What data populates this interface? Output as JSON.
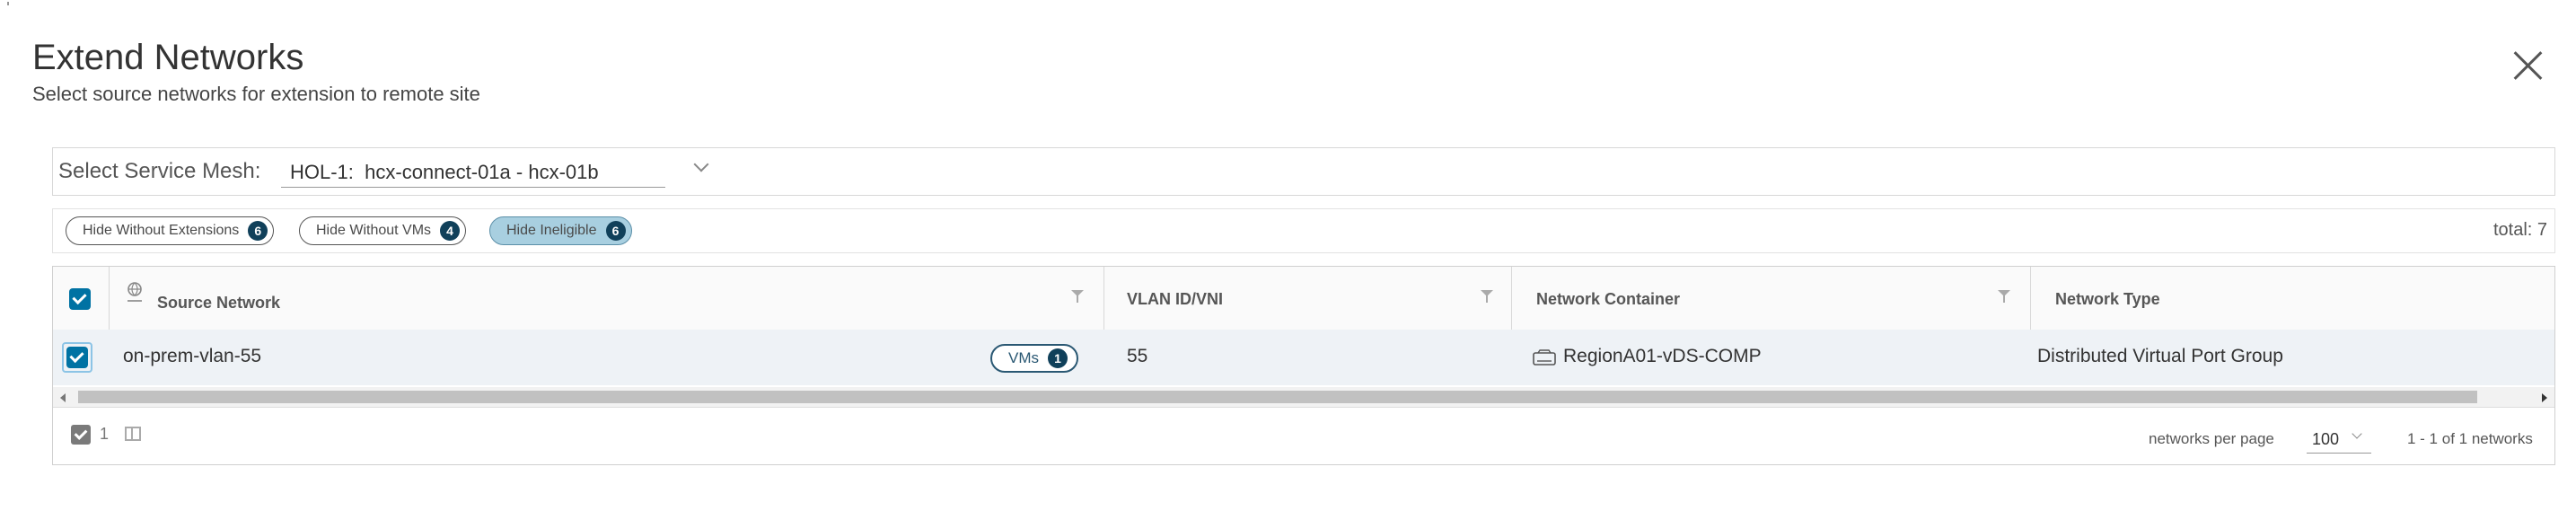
{
  "dialog": {
    "title": "Extend Networks",
    "subtitle": "Select source networks for extension to remote site"
  },
  "mesh": {
    "label": "Select Service Mesh:",
    "selected": "HOL-1:  hcx-connect-01a - hcx-01b"
  },
  "filters": [
    {
      "label": "Hide Without Extensions",
      "count": "6",
      "active": false
    },
    {
      "label": "Hide Without VMs",
      "count": "4",
      "active": false
    },
    {
      "label": "Hide Ineligible",
      "count": "6",
      "active": true
    }
  ],
  "total": "total: 7",
  "grid": {
    "columns": [
      "Source Network",
      "VLAN ID/VNI",
      "Network Container",
      "Network Type"
    ],
    "rows": [
      {
        "source": "on-prem-vlan-55",
        "vms_label": "VMs",
        "vms_count": "1",
        "vlan": "55",
        "container": "RegionA01-vDS-COMP",
        "type": "Distributed Virtual Port Group"
      }
    ],
    "footer": {
      "selected_count": "1",
      "per_page_label": "networks per page",
      "per_page_value": "100",
      "range": "1 - 1 of 1 networks"
    }
  },
  "colors": {
    "accent": "#0072a3",
    "badge": "#10405a",
    "active_pill": "#a8cfe0"
  }
}
